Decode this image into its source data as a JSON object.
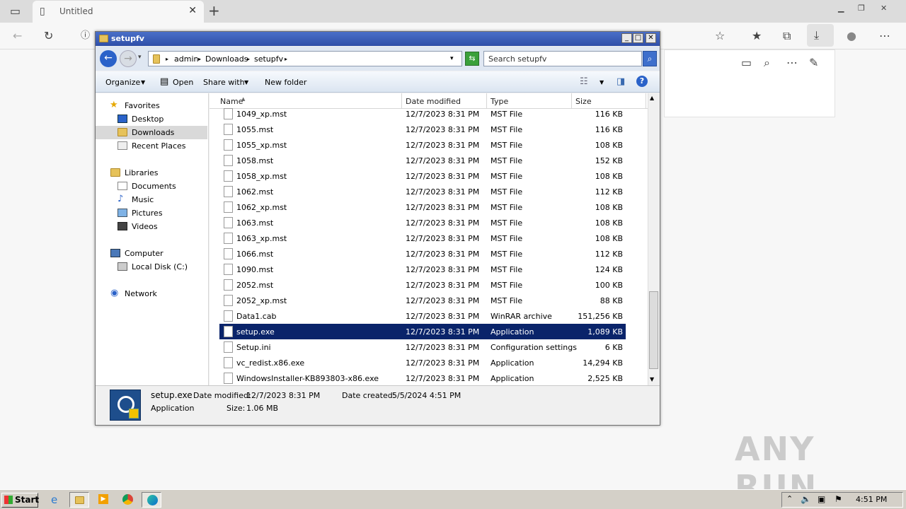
{
  "browser": {
    "tab_title": "Untitled",
    "accent": "#0078d4"
  },
  "window": {
    "title": "setupfv",
    "breadcrumb": [
      "admin",
      "Downloads",
      "setupfv"
    ],
    "search_placeholder": "Search setupfv",
    "commands": [
      "Organize",
      "Open",
      "Share with",
      "New folder"
    ]
  },
  "nav": {
    "favorites_label": "Favorites",
    "favorites": [
      "Desktop",
      "Downloads",
      "Recent Places"
    ],
    "libraries_label": "Libraries",
    "libraries": [
      "Documents",
      "Music",
      "Pictures",
      "Videos"
    ],
    "computer_label": "Computer",
    "computer": [
      "Local Disk (C:)"
    ],
    "network_label": "Network",
    "selected": "Downloads"
  },
  "columns": [
    "Name",
    "Date modified",
    "Type",
    "Size"
  ],
  "files": [
    {
      "name": "1049_xp.mst",
      "date": "12/7/2023 8:31 PM",
      "type": "MST File",
      "size": "116 KB"
    },
    {
      "name": "1055.mst",
      "date": "12/7/2023 8:31 PM",
      "type": "MST File",
      "size": "116 KB"
    },
    {
      "name": "1055_xp.mst",
      "date": "12/7/2023 8:31 PM",
      "type": "MST File",
      "size": "108 KB"
    },
    {
      "name": "1058.mst",
      "date": "12/7/2023 8:31 PM",
      "type": "MST File",
      "size": "152 KB"
    },
    {
      "name": "1058_xp.mst",
      "date": "12/7/2023 8:31 PM",
      "type": "MST File",
      "size": "108 KB"
    },
    {
      "name": "1062.mst",
      "date": "12/7/2023 8:31 PM",
      "type": "MST File",
      "size": "112 KB"
    },
    {
      "name": "1062_xp.mst",
      "date": "12/7/2023 8:31 PM",
      "type": "MST File",
      "size": "108 KB"
    },
    {
      "name": "1063.mst",
      "date": "12/7/2023 8:31 PM",
      "type": "MST File",
      "size": "108 KB"
    },
    {
      "name": "1063_xp.mst",
      "date": "12/7/2023 8:31 PM",
      "type": "MST File",
      "size": "108 KB"
    },
    {
      "name": "1066.mst",
      "date": "12/7/2023 8:31 PM",
      "type": "MST File",
      "size": "112 KB"
    },
    {
      "name": "1090.mst",
      "date": "12/7/2023 8:31 PM",
      "type": "MST File",
      "size": "124 KB"
    },
    {
      "name": "2052.mst",
      "date": "12/7/2023 8:31 PM",
      "type": "MST File",
      "size": "100 KB"
    },
    {
      "name": "2052_xp.mst",
      "date": "12/7/2023 8:31 PM",
      "type": "MST File",
      "size": "88 KB"
    },
    {
      "name": "Data1.cab",
      "date": "12/7/2023 8:31 PM",
      "type": "WinRAR archive",
      "size": "151,256 KB"
    },
    {
      "name": "setup.exe",
      "date": "12/7/2023 8:31 PM",
      "type": "Application",
      "size": "1,089 KB"
    },
    {
      "name": "Setup.ini",
      "date": "12/7/2023 8:31 PM",
      "type": "Configuration settings",
      "size": "6 KB"
    },
    {
      "name": "vc_redist.x86.exe",
      "date": "12/7/2023 8:31 PM",
      "type": "Application",
      "size": "14,294 KB"
    },
    {
      "name": "WindowsInstaller-KB893803-x86.exe",
      "date": "12/7/2023 8:31 PM",
      "type": "Application",
      "size": "2,525 KB"
    }
  ],
  "selected_file": "setup.exe",
  "details": {
    "name": "setup.exe",
    "modified_label": "Date modified:",
    "modified": "12/7/2023 8:31 PM",
    "created_label": "Date created:",
    "created": "5/5/2024 4:51 PM",
    "type": "Application",
    "size_label": "Size:",
    "size": "1.06 MB"
  },
  "taskbar": {
    "start_label": "Start",
    "clock": "4:51 PM"
  },
  "watermark": "ANY RUN"
}
